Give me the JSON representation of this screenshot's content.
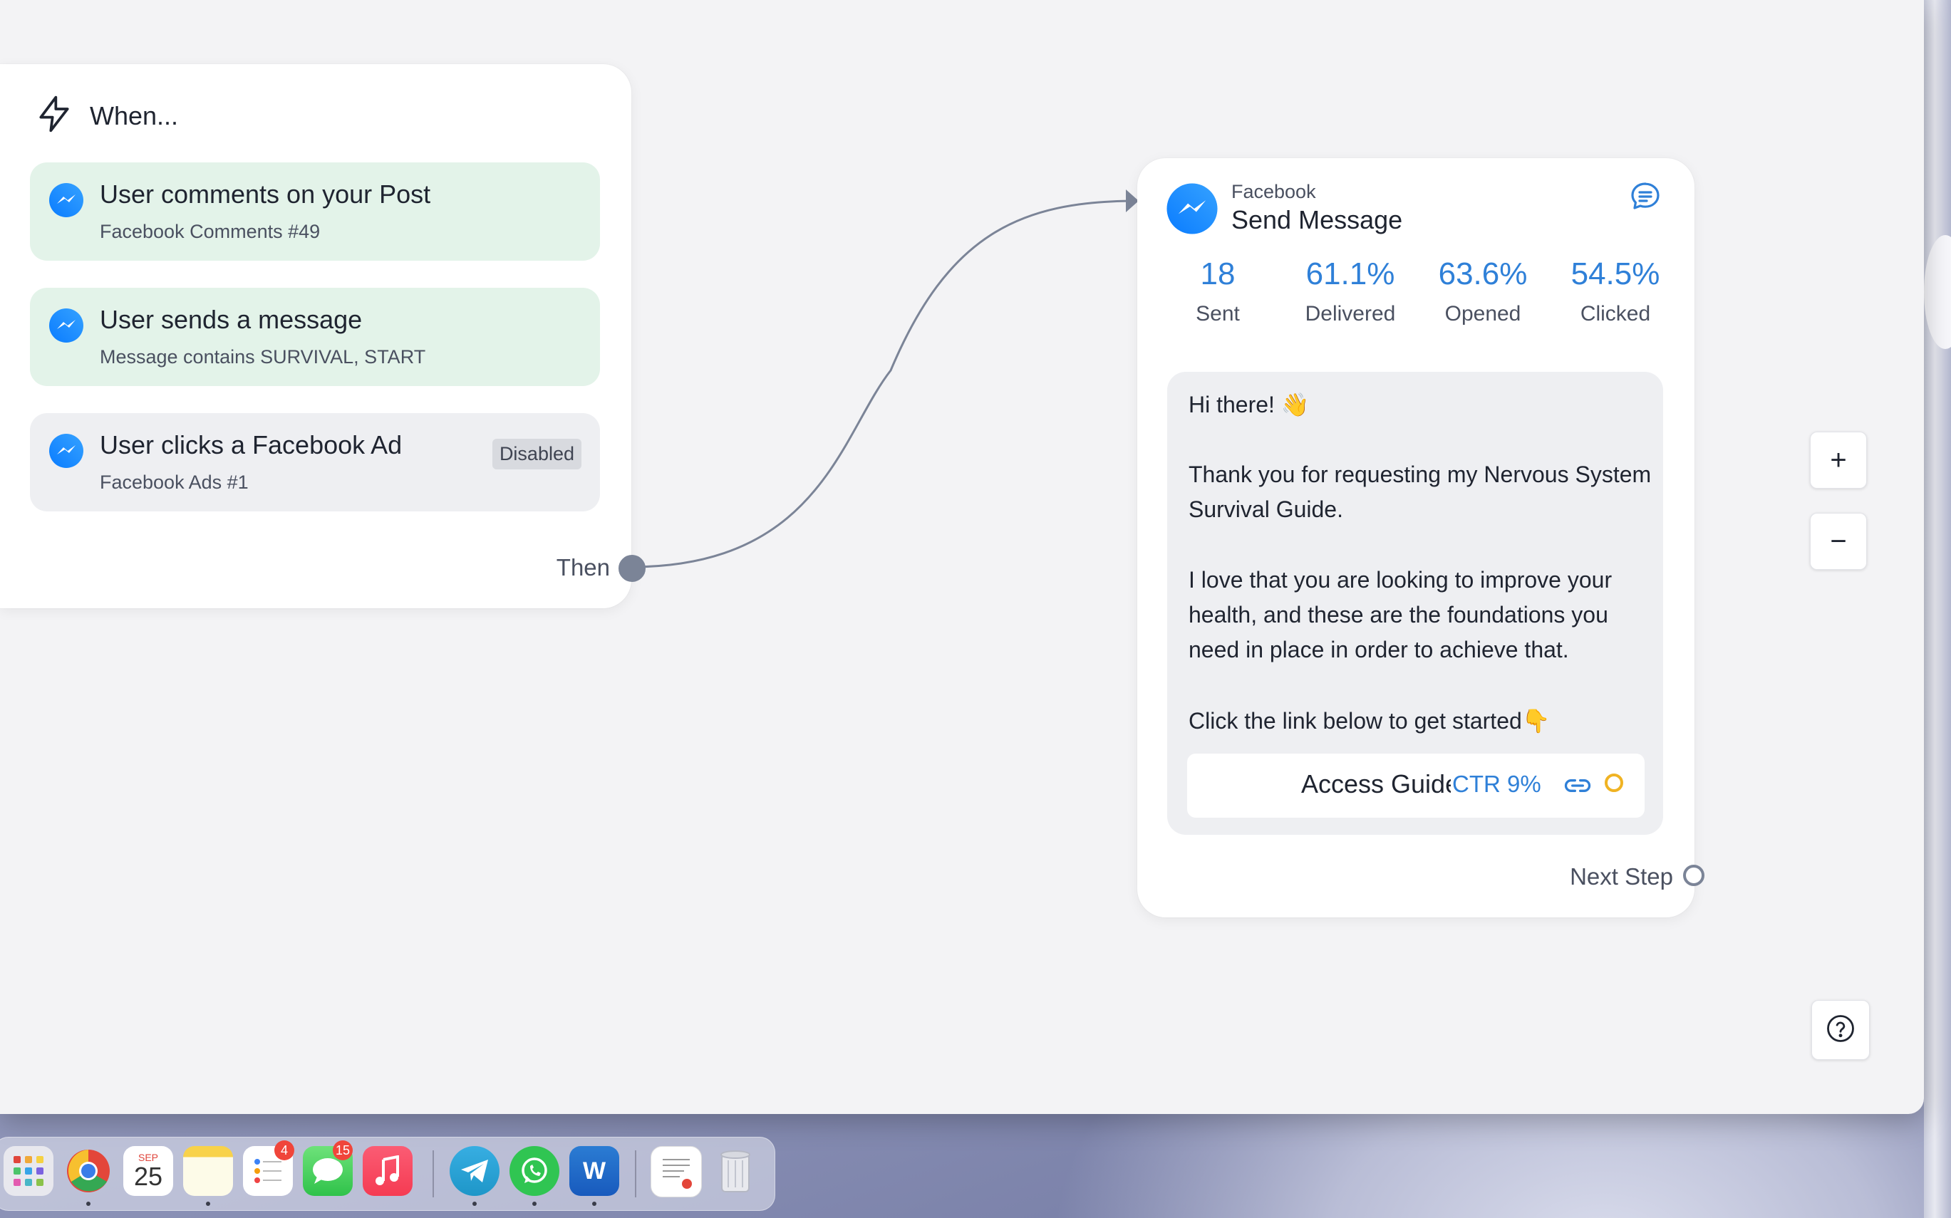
{
  "trigger": {
    "header": "When...",
    "items": [
      {
        "title": "User comments on your Post",
        "subtitle": "Facebook Comments #49",
        "state": "active"
      },
      {
        "title": "User sends a message",
        "subtitle": "Message contains SURVIVAL, START",
        "state": "active"
      },
      {
        "title": "User clicks a Facebook Ad",
        "subtitle": "Facebook Ads #1",
        "state": "disabled",
        "badge": "Disabled"
      }
    ],
    "then_label": "Then"
  },
  "message_step": {
    "provider": "Facebook",
    "action": "Send Message",
    "stats": [
      {
        "value": "18",
        "label": "Sent"
      },
      {
        "value": "61.1%",
        "label": "Delivered"
      },
      {
        "value": "63.6%",
        "label": "Opened"
      },
      {
        "value": "54.5%",
        "label": "Clicked"
      }
    ],
    "body": {
      "line1": "Hi there! 👋",
      "para2": "Thank you for requesting my Nervous System Survival Guide.",
      "para3": "I love that you are looking to improve your health, and these are the foundations you need in place in order to achieve that.",
      "para4": "Click the link below to get started👇"
    },
    "button": {
      "label": "Access Guide",
      "ctr": "CTR 9%"
    },
    "next_label": "Next Step"
  },
  "controls": {
    "zoom_in": "+",
    "zoom_out": "−",
    "help": "?"
  },
  "dock": {
    "calendar_month": "SEP",
    "calendar_day": "25",
    "reminders_badge": "4",
    "messages_badge": "15"
  },
  "colors": {
    "accent_blue": "#2f80d8",
    "trigger_active_bg": "#e3f3e9",
    "trigger_disabled_bg": "#eeeff2",
    "connector": "#7b8497",
    "button_status_ring": "#f0b323"
  },
  "icons": [
    "lightning-icon",
    "messenger-icon",
    "chat-bubble-icon",
    "link-icon",
    "help-icon"
  ]
}
